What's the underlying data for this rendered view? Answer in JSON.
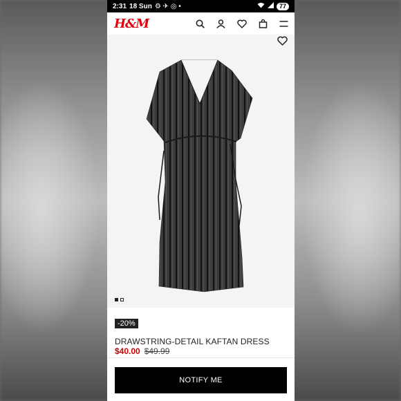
{
  "status_bar": {
    "time": "2:31",
    "day": "18 Sun",
    "battery": "77"
  },
  "header": {
    "logo": "H&M",
    "icons": [
      "search-icon",
      "account-icon",
      "heart-icon",
      "bag-icon",
      "menu-icon"
    ]
  },
  "gallery": {
    "image_alt": "Striped kaftan dress",
    "dots": [
      {
        "active": true
      },
      {
        "active": false
      }
    ]
  },
  "product": {
    "discount_badge": "-20%",
    "title": "DRAWSTRING-DETAIL KAFTAN DRESS",
    "sale_price": "$40.00",
    "original_price": "$49.99"
  },
  "cta": {
    "notify_label": "NOTIFY ME"
  },
  "colors": {
    "brand_red": "#e50010",
    "sale_red": "#cc0000",
    "button_bg": "#000000"
  }
}
